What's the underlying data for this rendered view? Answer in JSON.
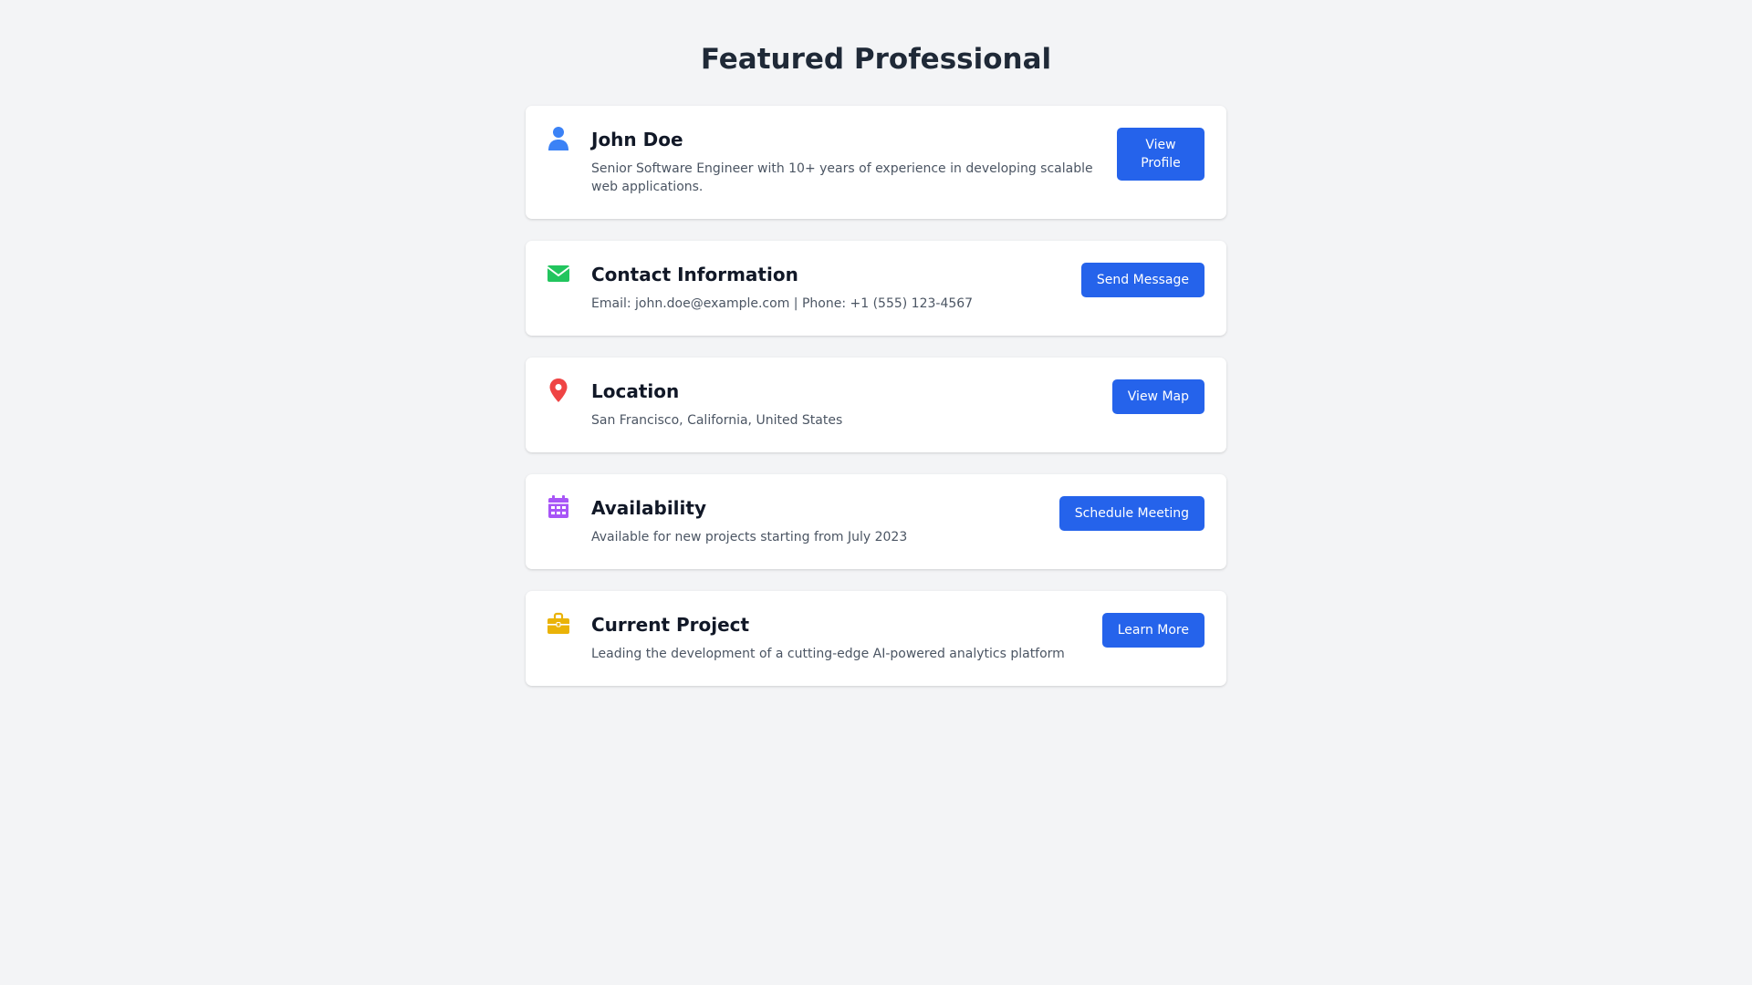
{
  "page": {
    "title": "Featured Professional"
  },
  "cards": [
    {
      "icon": "user-icon",
      "icon_color": "#3b82f6",
      "title": "John Doe",
      "description": "Senior Software Engineer with 10+ years of experience in developing scalable web applications.",
      "button": "View Profile"
    },
    {
      "icon": "envelope-icon",
      "icon_color": "#22c55e",
      "title": "Contact Information",
      "description": "Email: john.doe@example.com | Phone: +1 (555) 123-4567",
      "button": "Send Message"
    },
    {
      "icon": "map-pin-icon",
      "icon_color": "#ef4444",
      "title": "Location",
      "description": "San Francisco, California, United States",
      "button": "View Map"
    },
    {
      "icon": "calendar-icon",
      "icon_color": "#a855f7",
      "title": "Availability",
      "description": "Available for new projects starting from July 2023",
      "button": "Schedule Meeting"
    },
    {
      "icon": "briefcase-icon",
      "icon_color": "#eab308",
      "title": "Current Project",
      "description": "Leading the development of a cutting-edge AI-powered analytics platform",
      "button": "Learn More"
    }
  ],
  "theme": {
    "background": "#f3f4f6",
    "card_background": "#ffffff",
    "button_color": "#2563eb",
    "title_color": "#111827",
    "text_color": "#4b5563"
  }
}
